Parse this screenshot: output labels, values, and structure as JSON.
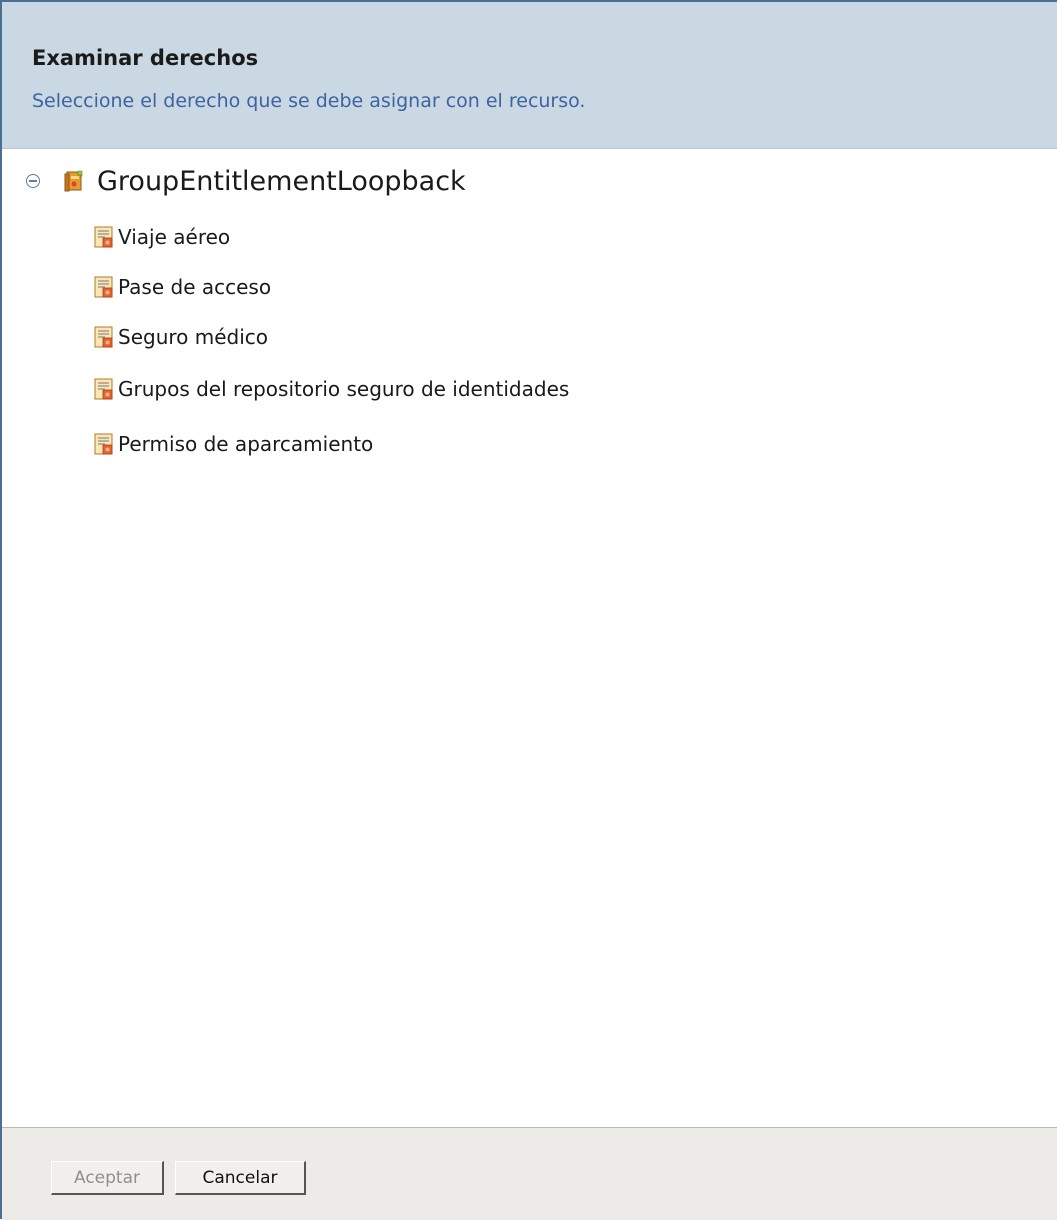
{
  "header": {
    "title": "Examinar derechos",
    "subtitle": "Seleccione el derecho que se debe asignar con el recurso."
  },
  "tree": {
    "root": {
      "label": "GroupEntitlementLoopback",
      "expanded": true,
      "icon": "book-icon"
    },
    "items": [
      {
        "label": "Viaje aéreo",
        "icon": "entitlement-doc-icon"
      },
      {
        "label": "Pase de acceso",
        "icon": "entitlement-doc-icon"
      },
      {
        "label": "Seguro médico",
        "icon": "entitlement-doc-icon"
      },
      {
        "label": "Grupos del repositorio seguro de identidades",
        "icon": "entitlement-doc-icon"
      },
      {
        "label": "Permiso de aparcamiento",
        "icon": "entitlement-doc-icon"
      }
    ]
  },
  "footer": {
    "accept_label": "Aceptar",
    "accept_enabled": false,
    "cancel_label": "Cancelar"
  },
  "colors": {
    "header_bg": "#cad8e4",
    "subtitle": "#3d63a1",
    "border": "#4a6e96",
    "footer_bg": "#ecebe7"
  }
}
